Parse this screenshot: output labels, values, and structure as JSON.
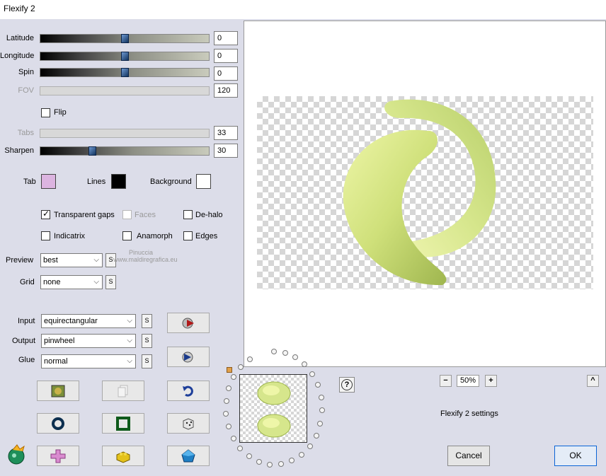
{
  "window": {
    "title": "Flexify 2"
  },
  "sliders": {
    "latitude": {
      "label": "Latitude",
      "value": "0",
      "level": 0.5
    },
    "longitude": {
      "label": "Longitude",
      "value": "0",
      "level": 0.5
    },
    "spin": {
      "label": "Spin",
      "value": "0",
      "level": 0.5
    },
    "fov": {
      "label": "FOV",
      "value": "120"
    },
    "tabs": {
      "label": "Tabs",
      "value": "33"
    },
    "sharpen": {
      "label": "Sharpen",
      "value": "30",
      "level": 0.3
    }
  },
  "flip": {
    "label": "Flip",
    "checked": false
  },
  "colors": {
    "tab": {
      "label": "Tab",
      "color": "#dcb4e0"
    },
    "lines": {
      "label": "Lines",
      "color": "#000000"
    },
    "background": {
      "label": "Background",
      "color": "#ffffff"
    }
  },
  "options": {
    "transparent_gaps": {
      "label": "Transparent gaps",
      "checked": true
    },
    "faces": {
      "label": "Faces",
      "checked": false,
      "disabled": true
    },
    "de_halo": {
      "label": "De-halo",
      "checked": false
    },
    "indicatrix": {
      "label": "Indicatrix",
      "checked": false
    },
    "anamorph": {
      "label": "Anamorph",
      "checked": false
    },
    "edges": {
      "label": "Edges",
      "checked": false
    }
  },
  "preview_select": {
    "label": "Preview",
    "value": "best"
  },
  "grid_select": {
    "label": "Grid",
    "value": "none"
  },
  "input_select": {
    "label": "Input",
    "value": "equirectangular"
  },
  "output_select": {
    "label": "Output",
    "value": "pinwheel"
  },
  "glue_select": {
    "label": "Glue",
    "value": "normal"
  },
  "s_label": "S",
  "watermark": {
    "line1": "Pinuccia",
    "line2": "www.maldiregrafica.eu"
  },
  "zoom": {
    "value": "50%",
    "minus": "−",
    "plus": "+"
  },
  "preset_label": "Flexify 2 settings",
  "collapse_label": "^",
  "help_label": "?",
  "buttons": {
    "cancel": "Cancel",
    "ok": "OK"
  },
  "accent": "#0a64d6"
}
